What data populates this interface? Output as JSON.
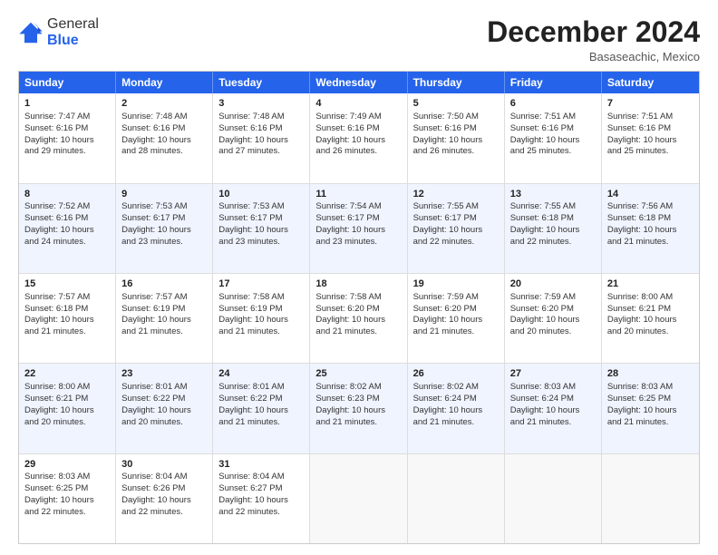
{
  "logo": {
    "general": "General",
    "blue": "Blue"
  },
  "header": {
    "title": "December 2024",
    "location": "Basaseachic, Mexico"
  },
  "weekdays": [
    "Sunday",
    "Monday",
    "Tuesday",
    "Wednesday",
    "Thursday",
    "Friday",
    "Saturday"
  ],
  "rows": [
    [
      {
        "day": "1",
        "lines": [
          "Sunrise: 7:47 AM",
          "Sunset: 6:16 PM",
          "Daylight: 10 hours",
          "and 29 minutes."
        ]
      },
      {
        "day": "2",
        "lines": [
          "Sunrise: 7:48 AM",
          "Sunset: 6:16 PM",
          "Daylight: 10 hours",
          "and 28 minutes."
        ]
      },
      {
        "day": "3",
        "lines": [
          "Sunrise: 7:48 AM",
          "Sunset: 6:16 PM",
          "Daylight: 10 hours",
          "and 27 minutes."
        ]
      },
      {
        "day": "4",
        "lines": [
          "Sunrise: 7:49 AM",
          "Sunset: 6:16 PM",
          "Daylight: 10 hours",
          "and 26 minutes."
        ]
      },
      {
        "day": "5",
        "lines": [
          "Sunrise: 7:50 AM",
          "Sunset: 6:16 PM",
          "Daylight: 10 hours",
          "and 26 minutes."
        ]
      },
      {
        "day": "6",
        "lines": [
          "Sunrise: 7:51 AM",
          "Sunset: 6:16 PM",
          "Daylight: 10 hours",
          "and 25 minutes."
        ]
      },
      {
        "day": "7",
        "lines": [
          "Sunrise: 7:51 AM",
          "Sunset: 6:16 PM",
          "Daylight: 10 hours",
          "and 25 minutes."
        ]
      }
    ],
    [
      {
        "day": "8",
        "lines": [
          "Sunrise: 7:52 AM",
          "Sunset: 6:16 PM",
          "Daylight: 10 hours",
          "and 24 minutes."
        ]
      },
      {
        "day": "9",
        "lines": [
          "Sunrise: 7:53 AM",
          "Sunset: 6:17 PM",
          "Daylight: 10 hours",
          "and 23 minutes."
        ]
      },
      {
        "day": "10",
        "lines": [
          "Sunrise: 7:53 AM",
          "Sunset: 6:17 PM",
          "Daylight: 10 hours",
          "and 23 minutes."
        ]
      },
      {
        "day": "11",
        "lines": [
          "Sunrise: 7:54 AM",
          "Sunset: 6:17 PM",
          "Daylight: 10 hours",
          "and 23 minutes."
        ]
      },
      {
        "day": "12",
        "lines": [
          "Sunrise: 7:55 AM",
          "Sunset: 6:17 PM",
          "Daylight: 10 hours",
          "and 22 minutes."
        ]
      },
      {
        "day": "13",
        "lines": [
          "Sunrise: 7:55 AM",
          "Sunset: 6:18 PM",
          "Daylight: 10 hours",
          "and 22 minutes."
        ]
      },
      {
        "day": "14",
        "lines": [
          "Sunrise: 7:56 AM",
          "Sunset: 6:18 PM",
          "Daylight: 10 hours",
          "and 21 minutes."
        ]
      }
    ],
    [
      {
        "day": "15",
        "lines": [
          "Sunrise: 7:57 AM",
          "Sunset: 6:18 PM",
          "Daylight: 10 hours",
          "and 21 minutes."
        ]
      },
      {
        "day": "16",
        "lines": [
          "Sunrise: 7:57 AM",
          "Sunset: 6:19 PM",
          "Daylight: 10 hours",
          "and 21 minutes."
        ]
      },
      {
        "day": "17",
        "lines": [
          "Sunrise: 7:58 AM",
          "Sunset: 6:19 PM",
          "Daylight: 10 hours",
          "and 21 minutes."
        ]
      },
      {
        "day": "18",
        "lines": [
          "Sunrise: 7:58 AM",
          "Sunset: 6:20 PM",
          "Daylight: 10 hours",
          "and 21 minutes."
        ]
      },
      {
        "day": "19",
        "lines": [
          "Sunrise: 7:59 AM",
          "Sunset: 6:20 PM",
          "Daylight: 10 hours",
          "and 21 minutes."
        ]
      },
      {
        "day": "20",
        "lines": [
          "Sunrise: 7:59 AM",
          "Sunset: 6:20 PM",
          "Daylight: 10 hours",
          "and 20 minutes."
        ]
      },
      {
        "day": "21",
        "lines": [
          "Sunrise: 8:00 AM",
          "Sunset: 6:21 PM",
          "Daylight: 10 hours",
          "and 20 minutes."
        ]
      }
    ],
    [
      {
        "day": "22",
        "lines": [
          "Sunrise: 8:00 AM",
          "Sunset: 6:21 PM",
          "Daylight: 10 hours",
          "and 20 minutes."
        ]
      },
      {
        "day": "23",
        "lines": [
          "Sunrise: 8:01 AM",
          "Sunset: 6:22 PM",
          "Daylight: 10 hours",
          "and 20 minutes."
        ]
      },
      {
        "day": "24",
        "lines": [
          "Sunrise: 8:01 AM",
          "Sunset: 6:22 PM",
          "Daylight: 10 hours",
          "and 21 minutes."
        ]
      },
      {
        "day": "25",
        "lines": [
          "Sunrise: 8:02 AM",
          "Sunset: 6:23 PM",
          "Daylight: 10 hours",
          "and 21 minutes."
        ]
      },
      {
        "day": "26",
        "lines": [
          "Sunrise: 8:02 AM",
          "Sunset: 6:24 PM",
          "Daylight: 10 hours",
          "and 21 minutes."
        ]
      },
      {
        "day": "27",
        "lines": [
          "Sunrise: 8:03 AM",
          "Sunset: 6:24 PM",
          "Daylight: 10 hours",
          "and 21 minutes."
        ]
      },
      {
        "day": "28",
        "lines": [
          "Sunrise: 8:03 AM",
          "Sunset: 6:25 PM",
          "Daylight: 10 hours",
          "and 21 minutes."
        ]
      }
    ],
    [
      {
        "day": "29",
        "lines": [
          "Sunrise: 8:03 AM",
          "Sunset: 6:25 PM",
          "Daylight: 10 hours",
          "and 22 minutes."
        ]
      },
      {
        "day": "30",
        "lines": [
          "Sunrise: 8:04 AM",
          "Sunset: 6:26 PM",
          "Daylight: 10 hours",
          "and 22 minutes."
        ]
      },
      {
        "day": "31",
        "lines": [
          "Sunrise: 8:04 AM",
          "Sunset: 6:27 PM",
          "Daylight: 10 hours",
          "and 22 minutes."
        ]
      },
      {
        "day": "",
        "lines": []
      },
      {
        "day": "",
        "lines": []
      },
      {
        "day": "",
        "lines": []
      },
      {
        "day": "",
        "lines": []
      }
    ]
  ]
}
